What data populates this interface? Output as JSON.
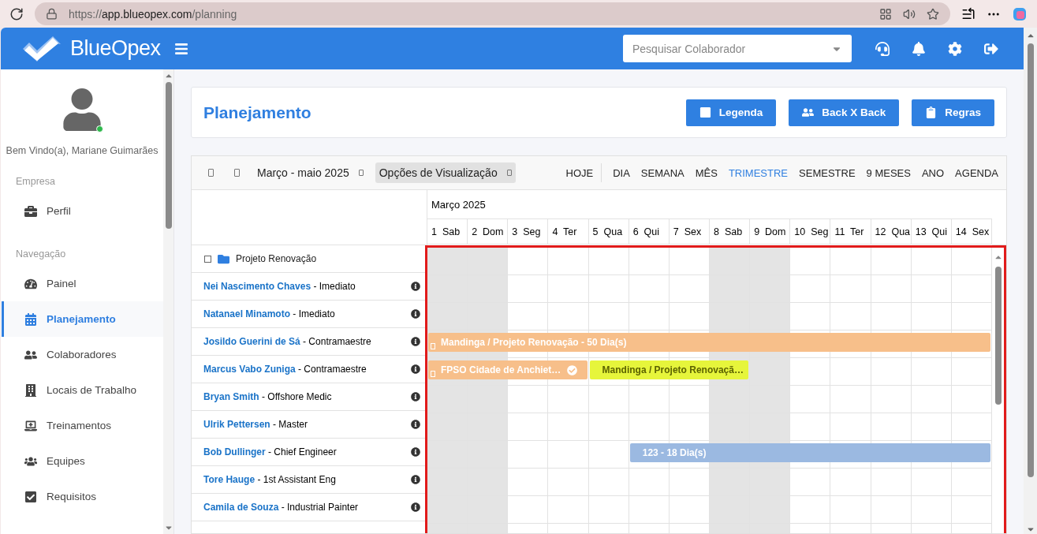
{
  "browser": {
    "scheme": "https://",
    "host": "app.blueopex.com",
    "path": "/planning"
  },
  "header": {
    "logo": "BlueOpex",
    "search": {
      "placeholder": "Pesquisar Colaborador"
    }
  },
  "sidebar": {
    "welcome": "Bem Vindo(a), Mariane Guimarães",
    "online": true,
    "sections": [
      {
        "title": "Empresa",
        "items": [
          {
            "label": "Perfil",
            "selected": false
          }
        ]
      },
      {
        "title": "Navegação",
        "items": [
          {
            "label": "Painel",
            "selected": false
          },
          {
            "label": "Planejamento",
            "selected": true
          },
          {
            "label": "Colaboradores",
            "selected": false
          },
          {
            "label": "Locais de Trabalho",
            "selected": false
          },
          {
            "label": "Treinamentos",
            "selected": false
          },
          {
            "label": "Equipes",
            "selected": false
          },
          {
            "label": "Requisitos",
            "selected": false
          }
        ]
      }
    ]
  },
  "page": {
    "title": "Planejamento",
    "buttons": [
      "Legenda",
      "Back X Back",
      "Regras"
    ]
  },
  "toolbar": {
    "range": "Março - maio 2025",
    "options": "Opções de Visualização",
    "today": "HOJE",
    "views": [
      {
        "label": "DIA",
        "selected": false
      },
      {
        "label": "SEMANA",
        "selected": false
      },
      {
        "label": "MÊS",
        "selected": false
      },
      {
        "label": "TRIMESTRE",
        "selected": true
      },
      {
        "label": "SEMESTRE",
        "selected": false
      },
      {
        "label": "9 MESES",
        "selected": false
      },
      {
        "label": "ANO",
        "selected": false
      },
      {
        "label": "AGENDA",
        "selected": false
      }
    ]
  },
  "timeline": {
    "month": "Março 2025",
    "highlighted": true,
    "days": [
      {
        "label": "1  Sab",
        "weekend": true
      },
      {
        "label": "2  Dom",
        "weekend": true
      },
      {
        "label": "3  Seg",
        "weekend": false
      },
      {
        "label": "4  Ter",
        "weekend": false
      },
      {
        "label": "5  Qua",
        "weekend": false
      },
      {
        "label": "6  Qui",
        "weekend": false
      },
      {
        "label": "7  Sex",
        "weekend": false
      },
      {
        "label": "8  Sab",
        "weekend": true
      },
      {
        "label": "9  Dom",
        "weekend": true
      },
      {
        "label": "10  Seg",
        "weekend": false
      },
      {
        "label": "11  Ter",
        "weekend": false
      },
      {
        "label": "12  Qua",
        "weekend": false
      },
      {
        "label": "13  Qui",
        "weekend": false
      },
      {
        "label": "14  Sex",
        "weekend": false
      }
    ],
    "group": {
      "name": "Projeto Renovação",
      "expanded": true
    },
    "rows": [
      {
        "text": "**Nei Nascimento Chaves** - Imediato",
        "bars": []
      },
      {
        "text": "**Natanael Minamoto** - Imediato",
        "bars": []
      },
      {
        "text": "**Josildo Guerini de Sá** - Contramaestre",
        "bars": [
          {
            "label": "Mandinga / Projeto Renovação - 50 Dia(s)",
            "color": "#f7bf8a",
            "marker": true,
            "confirmed": false
          }
        ]
      },
      {
        "text": "**Marcus Vabo Zuniga** - Contramaestre",
        "bars": [
          {
            "label": "FPSO Cidade de Anchiet…",
            "color": "#f7bf8a",
            "marker": true,
            "confirmed": true
          },
          {
            "label": "Mandinga / Projeto Renovaçã…",
            "color": "#e6f53b",
            "marker": false,
            "confirmed": false
          }
        ]
      },
      {
        "text": "**Bryan Smith** - Offshore Medic",
        "bars": []
      },
      {
        "text": "**Ulrik Pettersen** - Master",
        "bars": []
      },
      {
        "text": "**Bob Dullinger** - Chief Engineer",
        "bars": [
          {
            "label": "123 - 18 Dia(s)",
            "color": "#9bb9e1",
            "marker": false,
            "confirmed": false
          }
        ]
      },
      {
        "text": "**Tore Hauge** - 1st Assistant Eng",
        "bars": []
      },
      {
        "text": "**Camila de Souza** - Industrial Painter",
        "bars": []
      }
    ]
  }
}
